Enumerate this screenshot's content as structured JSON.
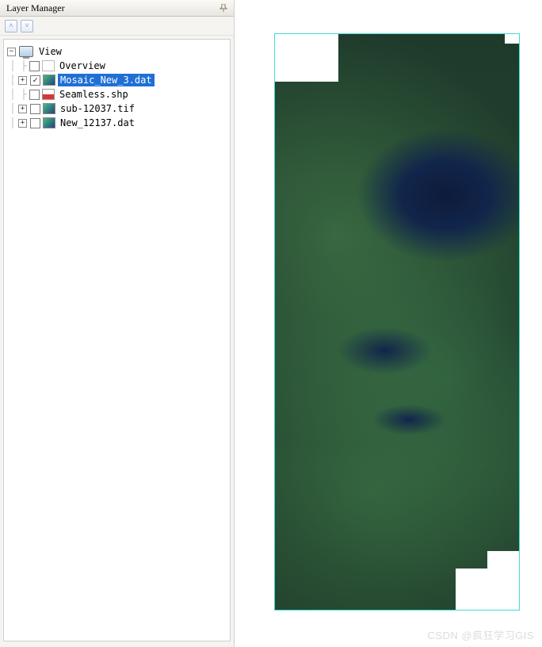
{
  "panel": {
    "title": "Layer Manager"
  },
  "toolbar": {
    "collapse_all_glyph": "˄",
    "expand_all_glyph": "˅"
  },
  "tree": {
    "root": {
      "label": "View",
      "expanded_glyph": "−"
    },
    "items": [
      {
        "label": "Overview",
        "checked": false,
        "checkmark": "",
        "expander": ""
      },
      {
        "label": "Mosaic_New_3.dat",
        "checked": true,
        "checkmark": "✓",
        "expander": "+",
        "selected": true
      },
      {
        "label": "Seamless.shp",
        "checked": false,
        "checkmark": "",
        "expander": ""
      },
      {
        "label": "sub-12037.tif",
        "checked": false,
        "checkmark": "",
        "expander": "+"
      },
      {
        "label": "New_12137.dat",
        "checked": false,
        "checkmark": "",
        "expander": "+"
      }
    ]
  },
  "watermark": "CSDN @疯狂学习GIS"
}
